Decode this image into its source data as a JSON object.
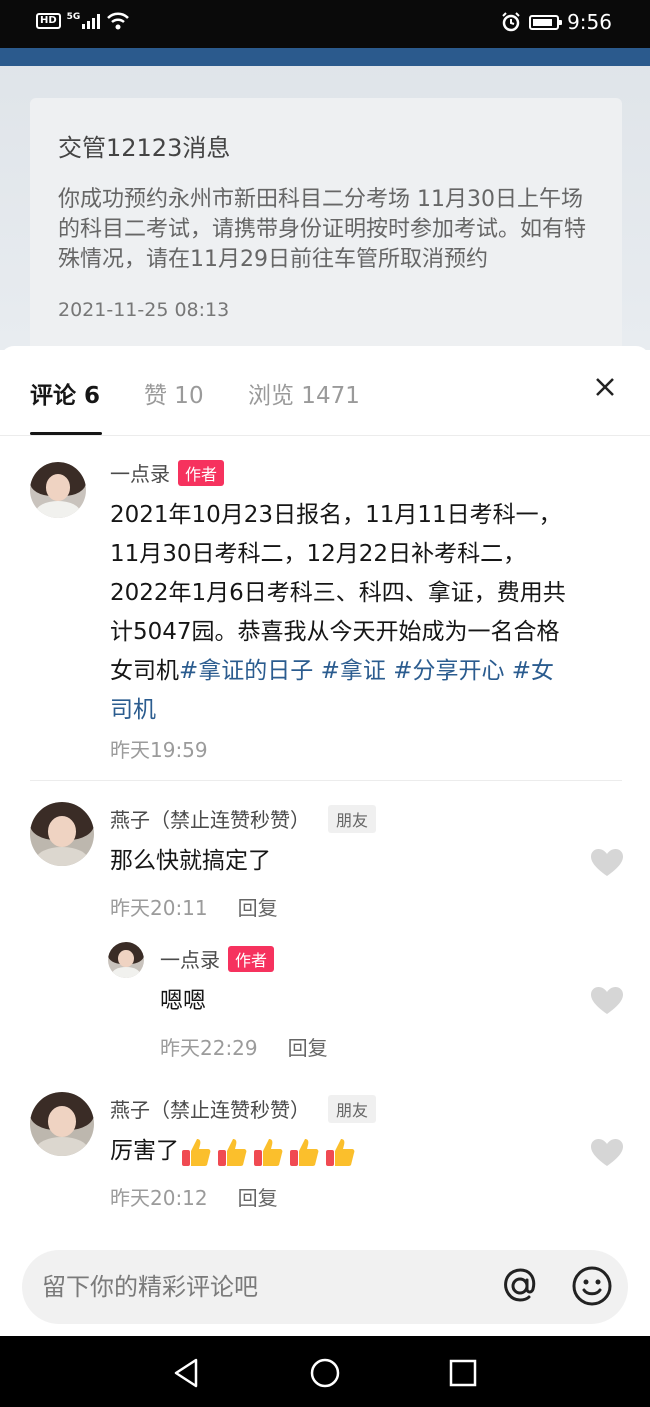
{
  "status_bar": {
    "hd_label": "HD",
    "network_label": "5G",
    "time": "9:56",
    "icons": [
      "signal-icon",
      "wifi-icon",
      "alarm-icon",
      "battery-icon"
    ]
  },
  "background_post": {
    "title": "交管12123消息",
    "body": "你成功预约永州市新田科目二分考场 11月30日上午场的科目二考试，请携带身份证明按时参加考试。如有特殊情况，请在11月29日前往车管所取消预约",
    "time": "2021-11-25 08:13"
  },
  "tabs": [
    {
      "label": "评论 6",
      "active": true
    },
    {
      "label": "赞 10",
      "active": false
    },
    {
      "label": "浏览 1471",
      "active": false
    }
  ],
  "close_icon": "close-icon",
  "comments": [
    {
      "user": "一点录",
      "badge": "作者",
      "text_main": "2021年10月23日报名，11月11日考科一，11月30日考科二，12月22日补考科二，2022年1月6日考科三、科四、拿证，费用共计5047园。恭喜我从今天开始成为一名合格女司机",
      "tags": [
        "#拿证的日子",
        "#拿证",
        "#分享开心",
        "#女司机"
      ],
      "time": "昨天19:59"
    },
    {
      "user": "燕子（禁止连赞秒赞）",
      "badge": "朋友",
      "text": "那么快就搞定了",
      "time": "昨天20:11",
      "reply_label": "回复",
      "reply": {
        "user": "一点录",
        "badge": "作者",
        "text": "嗯嗯",
        "time": "昨天22:29",
        "reply_label": "回复"
      }
    },
    {
      "user": "燕子（禁止连赞秒赞）",
      "badge": "朋友",
      "text": "厉害了",
      "emoji": "thumbs-up-emoji x5",
      "time": "昨天20:12",
      "reply_label": "回复"
    }
  ],
  "input": {
    "placeholder": "留下你的精彩评论吧",
    "value": ""
  },
  "colors": {
    "accent_author": "#f6325e",
    "tag_link": "#2b5c8f"
  }
}
